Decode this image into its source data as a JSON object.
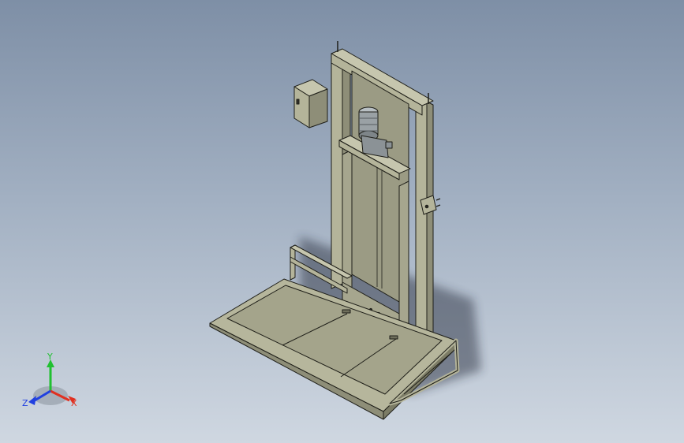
{
  "viewport": {
    "background_top": "#7e8fa6",
    "background_bottom": "#cfd7e1"
  },
  "model": {
    "part_color": "#b4b49a",
    "part_shadow": "#8e8e78",
    "edge_color": "#1e1e18",
    "motor_color": "#9aa1a5",
    "components": [
      "control-box",
      "mast-frame",
      "drive-motor",
      "platform-tray",
      "side-rail",
      "wall-bracket"
    ]
  },
  "triad": {
    "x_label": "X",
    "y_label": "Y",
    "z_label": "Z",
    "x_color": "#e03020",
    "y_color": "#20c030",
    "z_color": "#2040e0"
  }
}
